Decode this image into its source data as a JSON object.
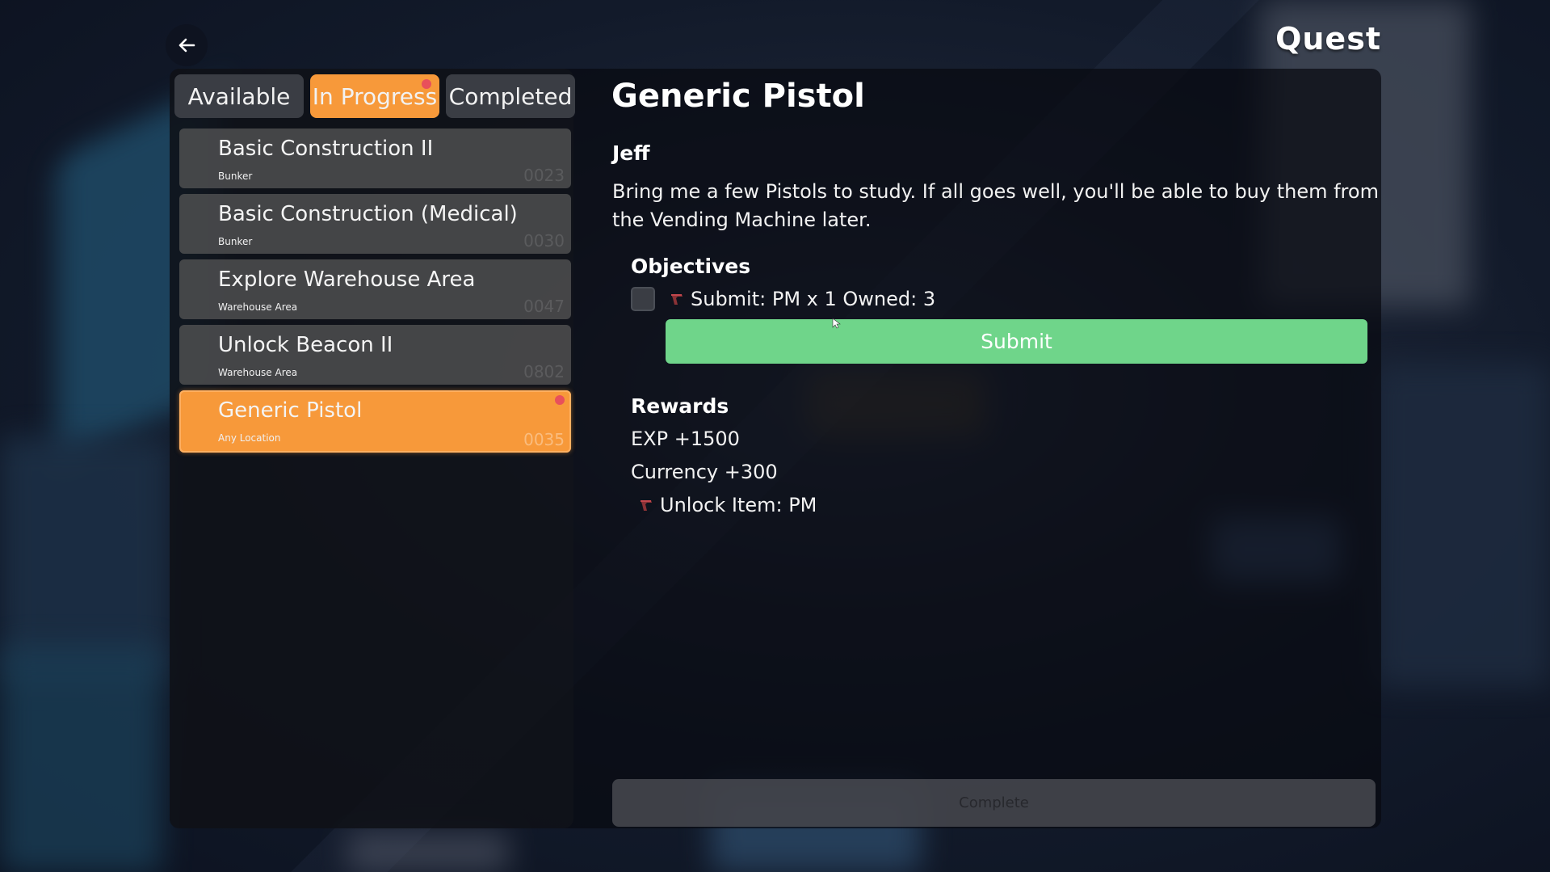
{
  "header": {
    "title": "Quest",
    "back_icon": "arrow-left-icon"
  },
  "tabs": [
    {
      "label": "Available",
      "active": false,
      "has_notification": false
    },
    {
      "label": "In Progress",
      "active": true,
      "has_notification": true
    },
    {
      "label": "Completed",
      "active": false,
      "has_notification": false
    }
  ],
  "quests": [
    {
      "name": "Basic Construction II",
      "location": "Bunker",
      "id": "0023",
      "active": false,
      "has_notification": false
    },
    {
      "name": "Basic Construction (Medical)",
      "location": "Bunker",
      "id": "0030",
      "active": false,
      "has_notification": false
    },
    {
      "name": "Explore Warehouse Area",
      "location": "Warehouse Area",
      "id": "0047",
      "active": false,
      "has_notification": false
    },
    {
      "name": "Unlock Beacon II",
      "location": "Warehouse Area",
      "id": "0802",
      "active": false,
      "has_notification": false
    },
    {
      "name": "Generic Pistol",
      "location": "Any Location",
      "id": "0035",
      "active": true,
      "has_notification": true
    }
  ],
  "detail": {
    "title": "Generic Pistol",
    "npc": "Jeff",
    "description": "Bring me a few Pistols to study. If all goes well, you'll be able to buy them from the Vending Machine later.",
    "objectives_heading": "Objectives",
    "objectives": [
      {
        "text": "Submit: PM x 1 Owned: 3",
        "icon": "pistol-icon",
        "checked": false
      }
    ],
    "submit_label": "Submit",
    "rewards_heading": "Rewards",
    "rewards": [
      {
        "text": "EXP +1500"
      },
      {
        "text": "Currency +300"
      },
      {
        "text": "Unlock Item: PM",
        "icon": "pistol-icon"
      }
    ],
    "complete_label": "Complete"
  },
  "colors": {
    "accent_orange": "#f7993a",
    "submit_green": "#6fd58a",
    "notification_red": "#e8505b",
    "tab_gray": "#3a3d44"
  }
}
